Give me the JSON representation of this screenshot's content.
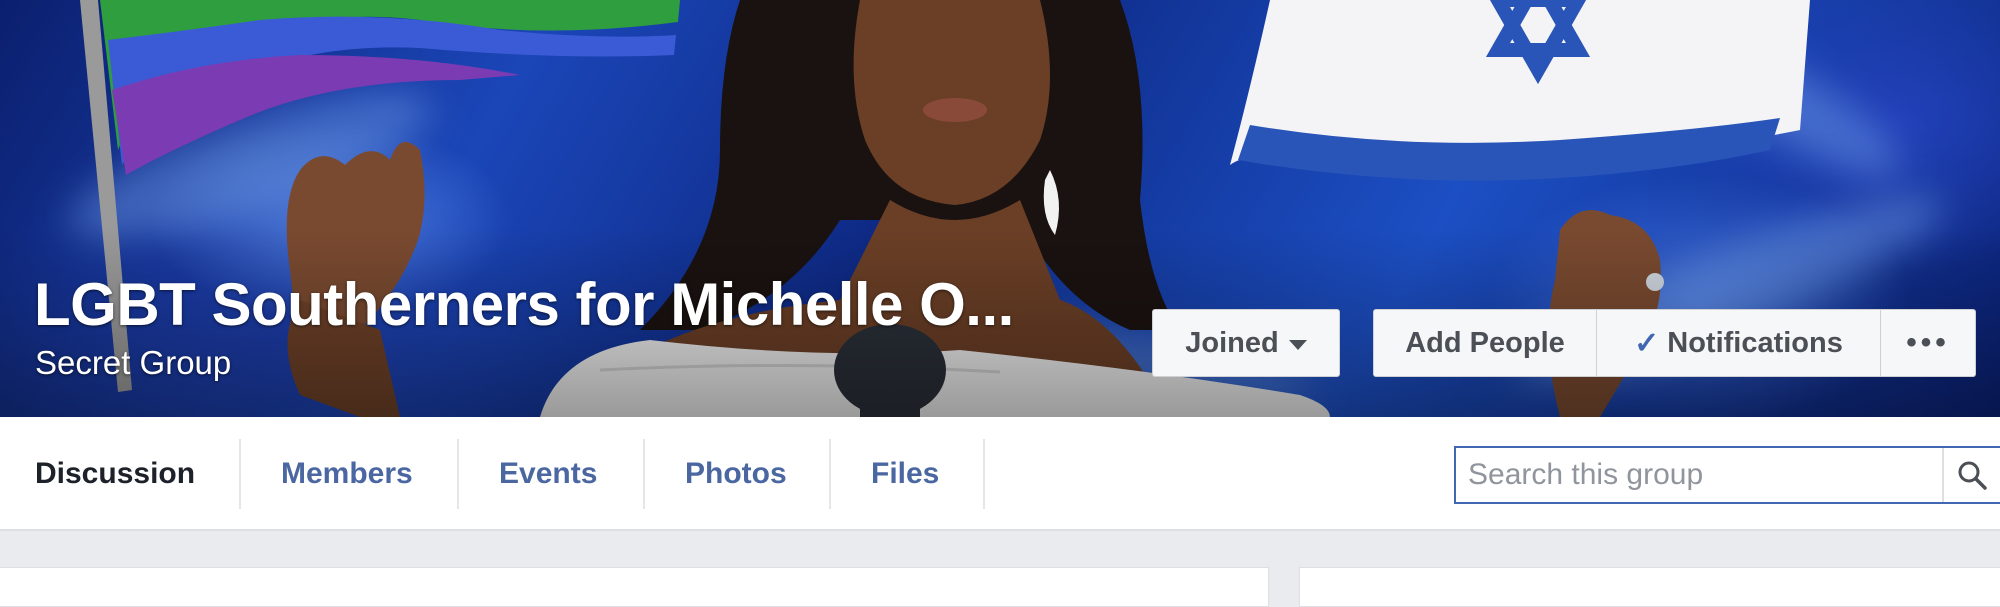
{
  "group": {
    "title": "LGBT Southerners for Michelle O...",
    "privacy": "Secret Group"
  },
  "cover_actions": {
    "joined_label": "Joined",
    "add_people_label": "Add People",
    "notifications_label": "Notifications",
    "more_label": "•••"
  },
  "tabs": [
    {
      "label": "Discussion",
      "active": true
    },
    {
      "label": "Members",
      "active": false
    },
    {
      "label": "Events",
      "active": false
    },
    {
      "label": "Photos",
      "active": false
    },
    {
      "label": "Files",
      "active": false
    }
  ],
  "search": {
    "placeholder": "Search this group"
  },
  "icons": {
    "joined": "caret-down-icon",
    "notifications": "check-icon",
    "search": "magnifier-icon"
  },
  "colors": {
    "link": "#4b67a1",
    "accent": "#4267b2",
    "active_tab": "#1d2129",
    "page_bg": "#e9ebee"
  }
}
